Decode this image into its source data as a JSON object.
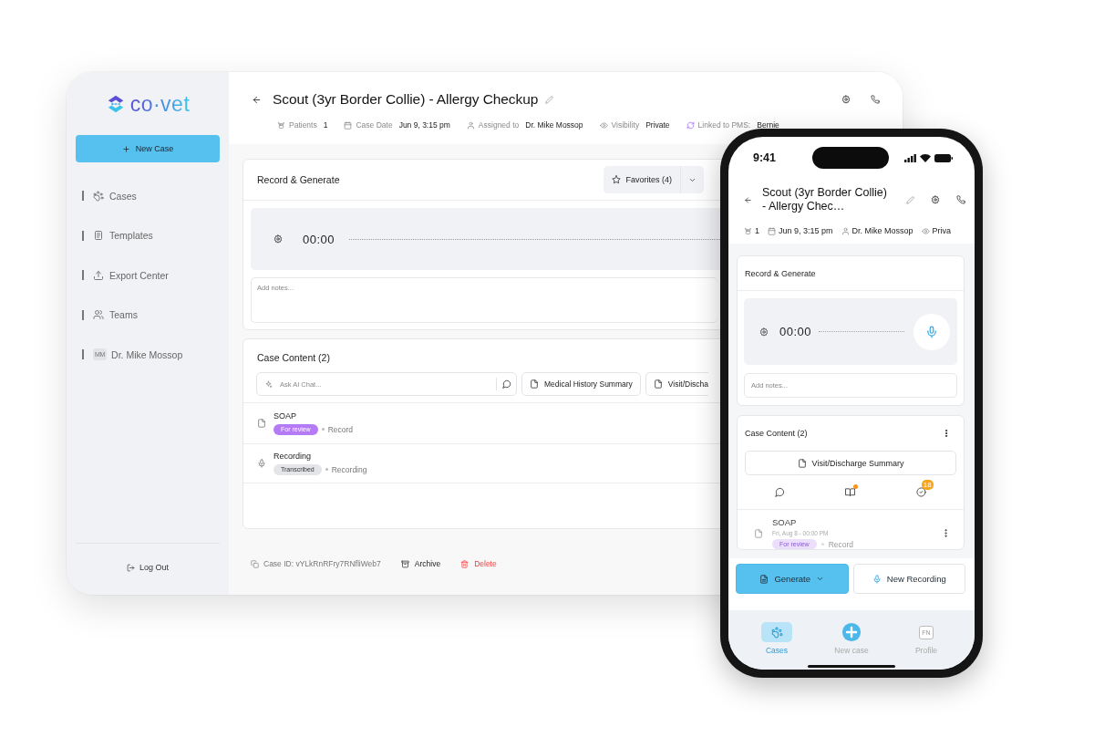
{
  "desktop": {
    "logo": "co·vet",
    "new_case_button": "New Case",
    "sidebar": {
      "items": [
        {
          "kind": "link",
          "label": "Cases"
        },
        {
          "kind": "link",
          "label": "Templates"
        },
        {
          "kind": "link",
          "label": "Export Center"
        },
        {
          "kind": "link",
          "label": "Teams"
        },
        {
          "kind": "user",
          "label": "Dr. Mike Mossop",
          "avatar": "MM"
        }
      ]
    },
    "log_out": "Log Out",
    "header": {
      "title": "Scout (3yr Border Collie) - Allergy Checkup",
      "meta": [
        {
          "label": "Patients",
          "value": "1"
        },
        {
          "label": "Case Date",
          "value": "Jun 9, 3:15 pm"
        },
        {
          "label": "Assigned to",
          "value": "Dr. Mike Mossop"
        },
        {
          "label": "Visibility",
          "value": "Private"
        },
        {
          "label": "Linked to PMS:",
          "value": "Bernie"
        }
      ]
    },
    "record_card": {
      "title": "Record & Generate",
      "favorites_button": "Favorites (4)",
      "timer": "00:00",
      "notes": {
        "placeholder": "Add notes..."
      }
    },
    "content_card": {
      "title": "Case Content (2)",
      "chat": {
        "placeholder": "Ask AI Chat..."
      },
      "actions": [
        "Medical History Summary",
        "Visit/Discha"
      ],
      "items": [
        {
          "kind": "document",
          "title": "SOAP",
          "status": "For review",
          "color": "#b57bf7",
          "source": "Record"
        },
        {
          "kind": "recording",
          "title": "Recording",
          "status": "Transcribed",
          "color": "#e4e5e8",
          "source": "Recording"
        }
      ]
    },
    "footer": {
      "case_id": "Case ID: vYLkRnRFry7RNfliWeb7",
      "archive_button": "Archive",
      "delete_button": "Delete"
    }
  },
  "phone": {
    "status_bar": {
      "time": "9:41"
    },
    "header": {
      "title": "Scout (3yr Border Collie) - Allergy Chec…",
      "meta": [
        "1",
        "Jun 9, 3:15 pm",
        "Dr. Mike Mossop",
        "Priva"
      ]
    },
    "record_card": {
      "title": "Record & Generate",
      "timer": "00:00",
      "notes": {
        "placeholder": "Add notes..."
      }
    },
    "content_card": {
      "title": "Case Content (2)",
      "summary_button": "Visit/Discharge Summary",
      "tools": [
        {
          "dot": false
        },
        {
          "dot": true
        },
        {
          "badge": "18"
        }
      ],
      "items": [
        {
          "kind": "document",
          "title": "SOAP",
          "date": "Fri, Aug 8 - 00:00 PM",
          "status": "For review",
          "color": "#ecdffc",
          "source": "Record"
        }
      ]
    },
    "generate_button": "Generate",
    "new_recording_button": "New Recording",
    "tabs": [
      {
        "label": "Cases",
        "selected": true
      },
      {
        "label": "New case",
        "selected": false
      },
      {
        "label": "Profile",
        "selected": false,
        "avatar": "FN"
      }
    ]
  }
}
